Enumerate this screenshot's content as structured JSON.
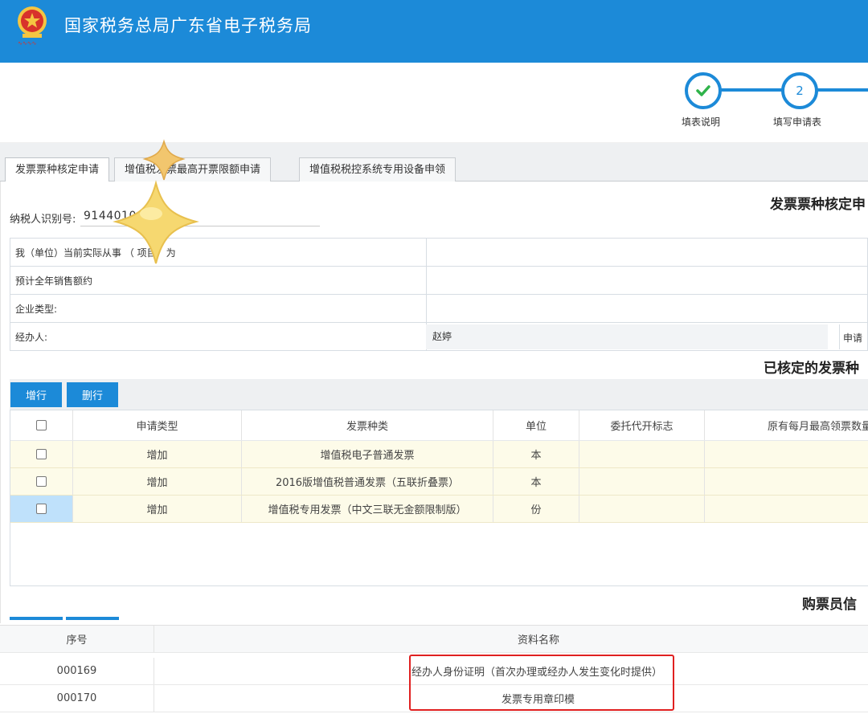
{
  "header": {
    "title": "国家税务总局广东省电子税务局",
    "brand_color": "#1c8ad8"
  },
  "stepper": {
    "steps": [
      {
        "label": "填表说明",
        "number": "",
        "status": "done"
      },
      {
        "label": "填写申请表",
        "number": "2",
        "status": "current"
      }
    ]
  },
  "tabs": [
    {
      "label": "发票票种核定申请",
      "active": true
    },
    {
      "label": "增值税发票最高开票限额申请",
      "active": false
    },
    {
      "label": "增值税税控系统专用设备申领",
      "active": false
    }
  ],
  "form": {
    "section_title": "发票票种核定申",
    "taxpayer_id_label": "纳税人识别号:",
    "taxpayer_id_value": "9144010                U982",
    "rows": [
      {
        "label": "我（单位）当前实际从事         （         项目）为",
        "value": ""
      },
      {
        "label": "预计全年销售额约",
        "value": ""
      },
      {
        "label": "企业类型:",
        "value": ""
      },
      {
        "label": "经办人:",
        "value": "赵婷",
        "extra_label": "申请"
      }
    ]
  },
  "approved_section": {
    "title": "已核定的发票种",
    "buttons": {
      "add_row": "增行",
      "delete_row": "删行"
    },
    "columns": [
      "申请类型",
      "发票种类",
      "单位",
      "委托代开标志",
      "原有每月最高领票数量"
    ],
    "rows": [
      {
        "type": "增加",
        "invoice_kind": "增值税电子普通发票",
        "unit": "本",
        "delegate": "",
        "monthly_max": "",
        "selected": false
      },
      {
        "type": "增加",
        "invoice_kind": "2016版增值税普通发票（五联折叠票）",
        "unit": "本",
        "delegate": "",
        "monthly_max": "",
        "selected": false
      },
      {
        "type": "增加",
        "invoice_kind": "增值税专用发票（中文三联无金额限制版）",
        "unit": "份",
        "delegate": "",
        "monthly_max": "",
        "selected": true
      }
    ]
  },
  "buyer_section": {
    "title": "购票员信"
  },
  "documents": {
    "columns": [
      "序号",
      "资料名称"
    ],
    "rows": [
      {
        "no": "000169",
        "name": "经办人身份证明（首次办理或经办人发生变化时提供）"
      },
      {
        "no": "000170",
        "name": "发票专用章印模"
      }
    ],
    "highlight_color": "#e02020"
  }
}
